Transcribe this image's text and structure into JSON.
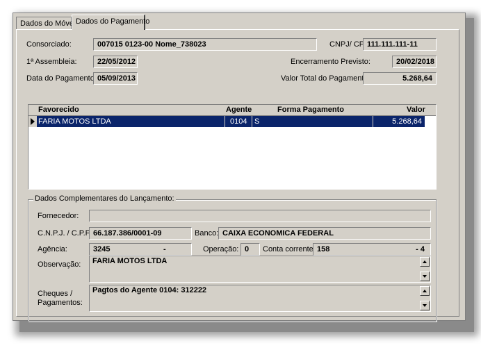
{
  "tabs": [
    {
      "label": "Dados do Móvel"
    },
    {
      "label": "Dados do Pagamento"
    }
  ],
  "header": {
    "consorciado_label": "Consorciado:",
    "consorciado_value": "007015 0123-00  Nome_738023",
    "cnpj_label": "CNPJ/ CPF:",
    "cnpj_value": "111.111.111-11",
    "assembleia_label": "1ª Assembleia:",
    "assembleia_value": "22/05/2012",
    "encerramento_label": "Encerramento Previsto:",
    "encerramento_value": "20/02/2018",
    "data_pagamento_label": "Data do Pagamento:",
    "data_pagamento_value": "05/09/2013",
    "valor_total_label": "Valor Total do Pagamento:",
    "valor_total_value": "5.268,64"
  },
  "grid": {
    "columns": [
      "Favorecido",
      "Agente",
      "Forma Pagamento",
      "Valor"
    ],
    "rows": [
      {
        "favorecido": "FARIA MOTOS LTDA",
        "agente": "0104",
        "forma": "S",
        "valor": "5.268,64"
      }
    ]
  },
  "complementares": {
    "title": "Dados Complementares do Lançamento:",
    "fornecedor_label": "Fornecedor:",
    "fornecedor_value": "",
    "cnpj_label": "C.N.P.J. / C.P.F.:",
    "cnpj_value": "66.187.386/0001-09",
    "banco_label": "Banco:",
    "banco_value": "CAIXA ECONOMICA FEDERAL",
    "agencia_label": "Agência:",
    "agencia_value": "3245",
    "agencia_dv": "-",
    "operacao_label": "Operação:",
    "operacao_value": "0",
    "conta_label": "Conta corrente:",
    "conta_value": "158",
    "conta_dv": "-  4",
    "observacao_label": "Observação:",
    "observacao_value": "FARIA MOTOS LTDA",
    "cheques_label_1": "Cheques /",
    "cheques_label_2": "Pagamentos:",
    "cheques_value": "Pagtos do Agente 0104: 312222"
  }
}
